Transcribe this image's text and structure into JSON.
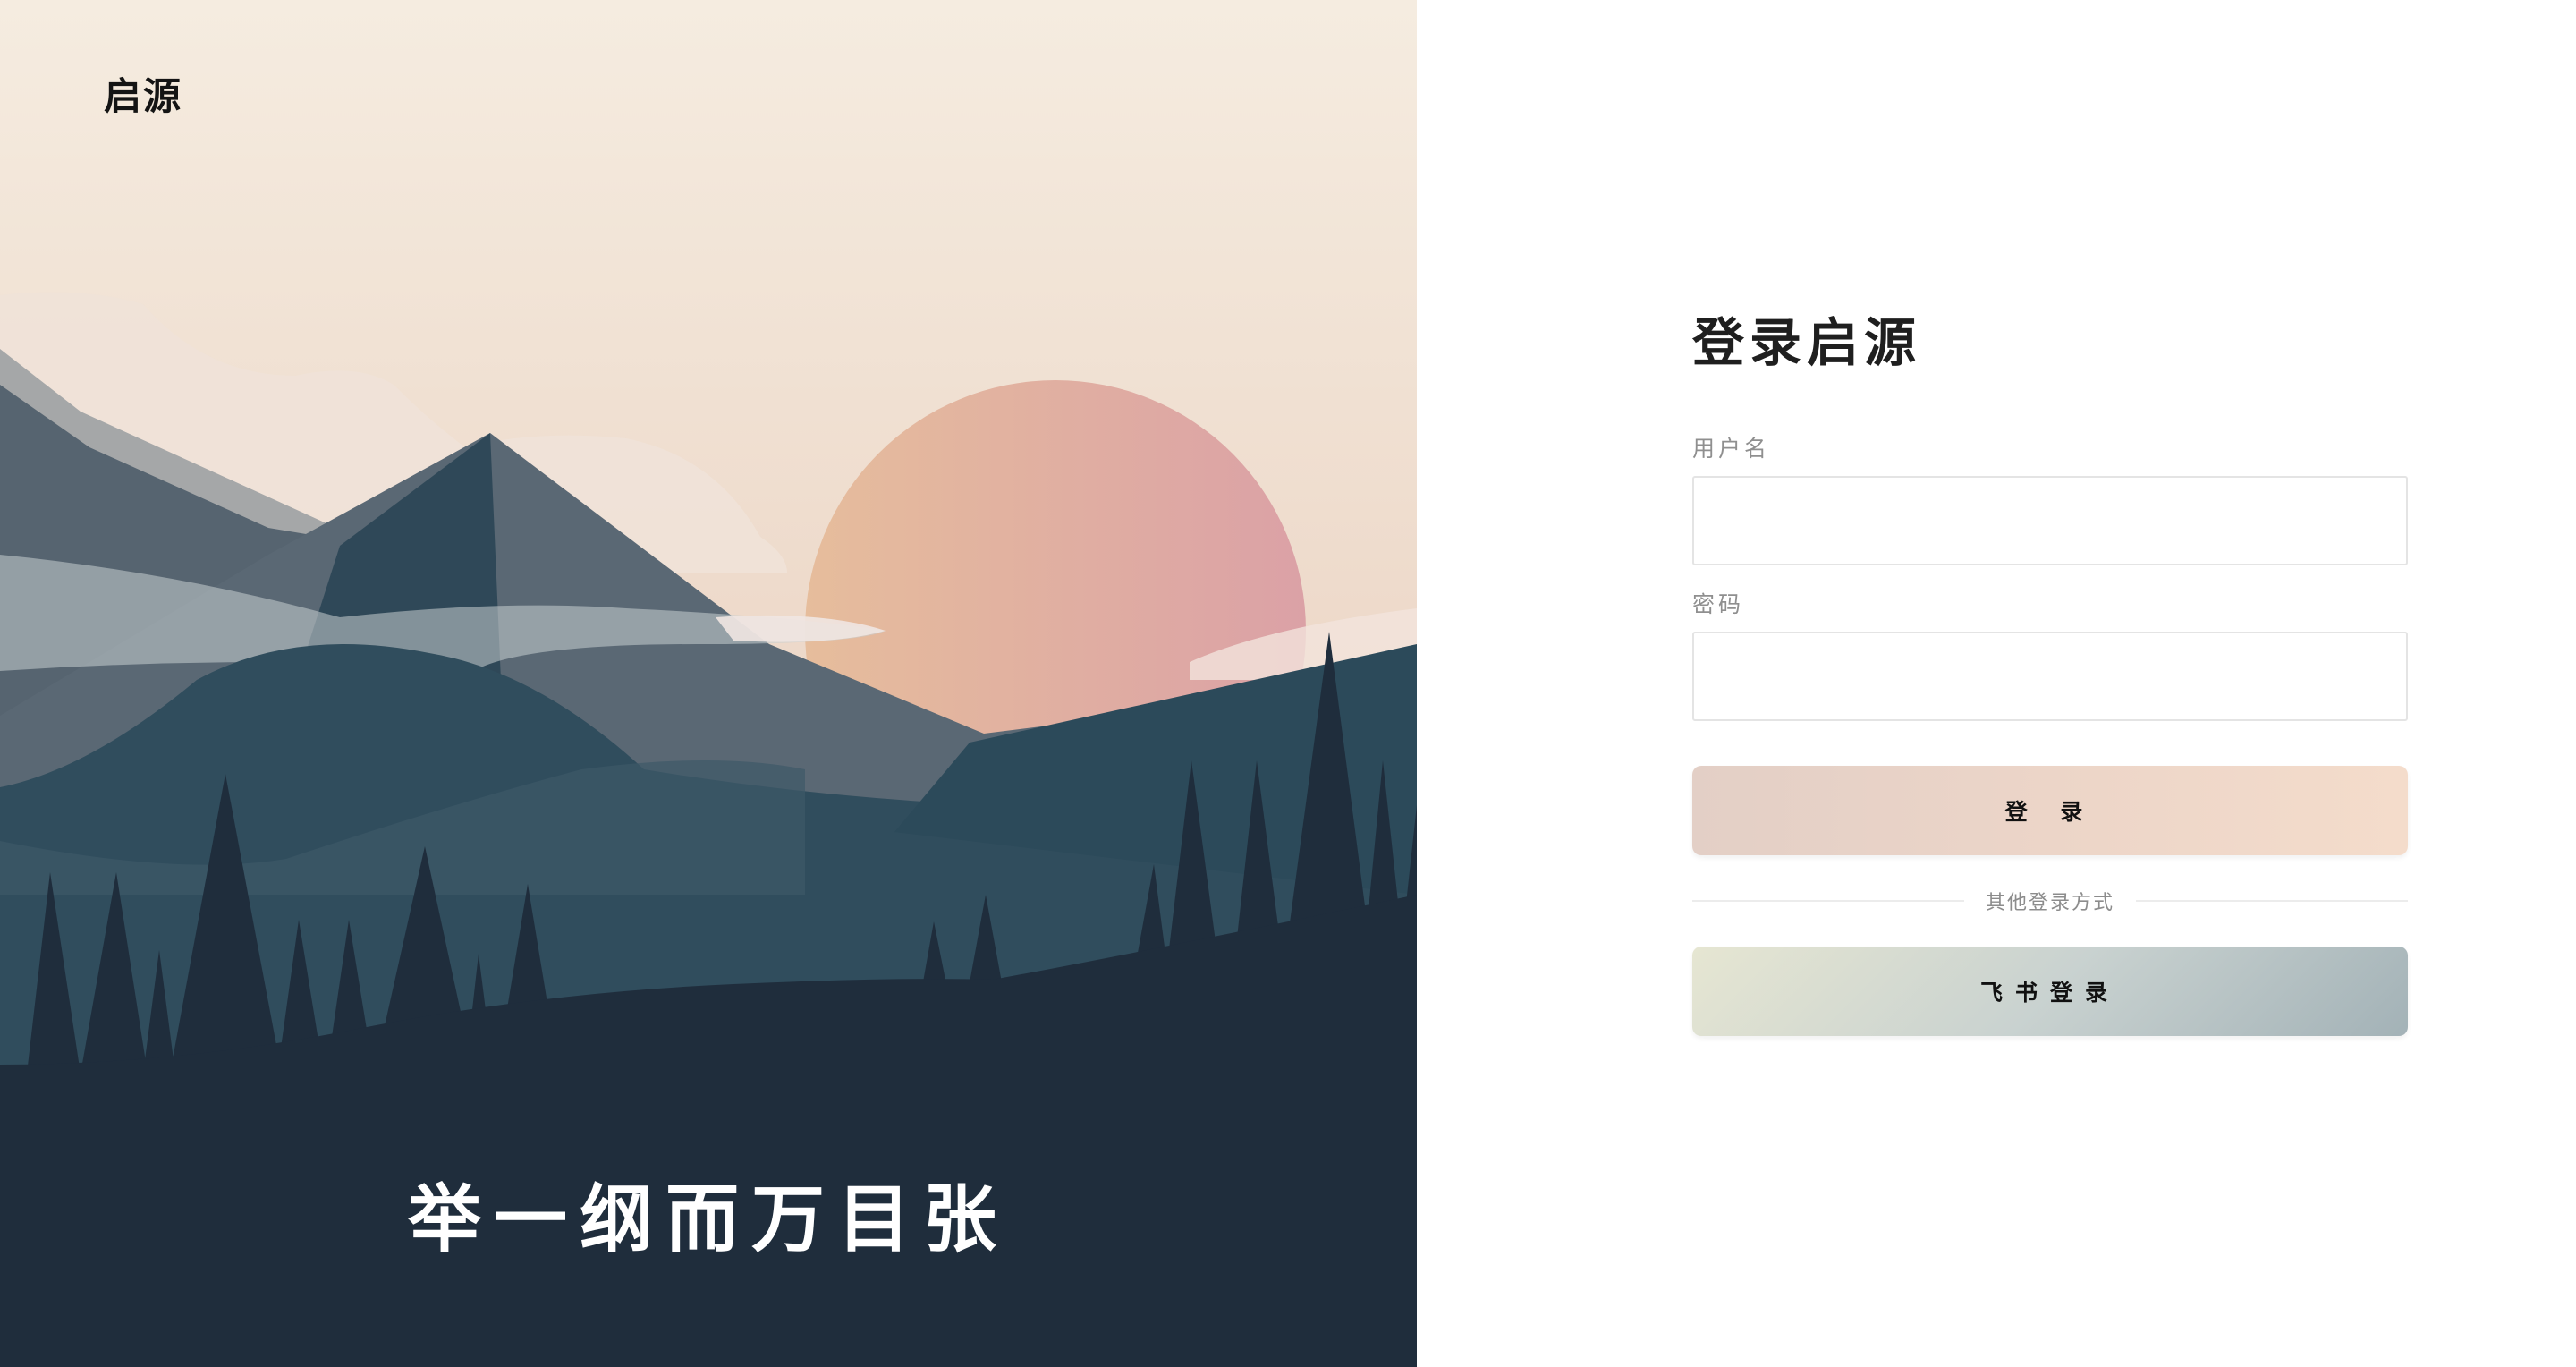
{
  "brand": {
    "name": "启源"
  },
  "hero": {
    "slogan": "举一纲而万目张"
  },
  "login": {
    "title": "登录启源",
    "username": {
      "label": "用户名",
      "value": "",
      "placeholder": ""
    },
    "password": {
      "label": "密码",
      "value": "",
      "placeholder": ""
    },
    "submit_label": "登 录",
    "divider_text": "其他登录方式",
    "feishu_label": "飞书登录"
  },
  "colors": {
    "login_button": "#ecd5c8",
    "feishu_button": "#c9d2d0",
    "dark_ground": "#1f2d3c",
    "sun": "#e2b0a0"
  }
}
